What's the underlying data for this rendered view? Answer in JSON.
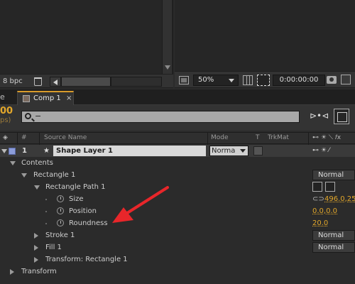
{
  "upper": {
    "bpc_label": "8 bpc",
    "zoom_value": "50%",
    "timecode": "0:00:00:00"
  },
  "tabs": {
    "previous_fragment": "e",
    "active_label": "Comp 1",
    "close_label": "×"
  },
  "comp_controls": {
    "current_time_fragment": "00",
    "fps_fragment": "ps)",
    "search_value": "−"
  },
  "columns": {
    "num": "#",
    "source_name": "Source Name",
    "mode": "Mode",
    "t": "T",
    "trkmat": "TrkMat"
  },
  "layer": {
    "index": "1",
    "name": "Shape Layer 1",
    "mode": "Norma"
  },
  "tree": {
    "contents": "Contents",
    "rectangle1": "Rectangle 1",
    "rectangle1_mode": "Normal",
    "rect_path": "Rectangle Path 1",
    "size_label": "Size",
    "size_value": "496.0,25",
    "position_label": "Position",
    "position_value": "0.0,0.0",
    "roundness_label": "Roundness",
    "roundness_value": "20.0",
    "stroke": "Stroke 1",
    "stroke_mode": "Normal",
    "fill": "Fill 1",
    "fill_mode": "Normal",
    "transform_rect": "Transform: Rectangle 1",
    "transform": "Transform"
  },
  "annotation": {
    "arrow_color": "#e8262a"
  }
}
